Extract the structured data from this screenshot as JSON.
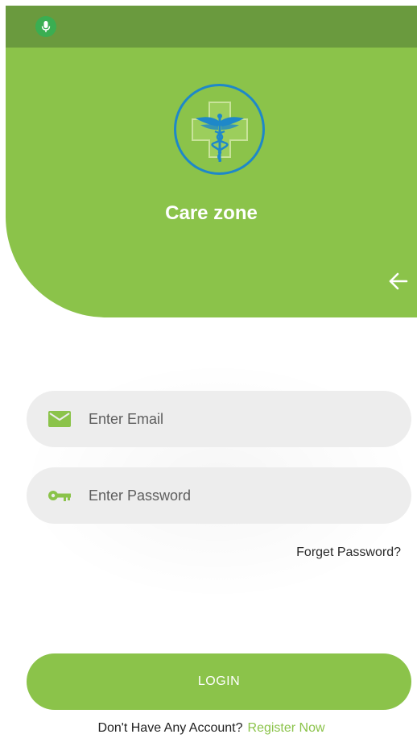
{
  "status_bar": {
    "mic_icon": "microphone-icon",
    "mic_color": "#3aae52"
  },
  "header": {
    "app_name": "Care zone",
    "logo_icon": "medical-caduceus-icon",
    "back_icon": "arrow-left-icon",
    "background": "#8bc34a"
  },
  "login_form": {
    "email_placeholder": "Enter Email",
    "email_icon": "envelope-icon",
    "password_placeholder": "Enter Password",
    "password_icon": "key-icon",
    "forget_label": "Forget Password?",
    "login_label": "LOGIN"
  },
  "footer": {
    "no_account_text": "Don't Have Any Account?",
    "register_label": "Register Now"
  },
  "colors": {
    "accent": "#8bc34a",
    "logo_ring": "#1e88c9"
  }
}
